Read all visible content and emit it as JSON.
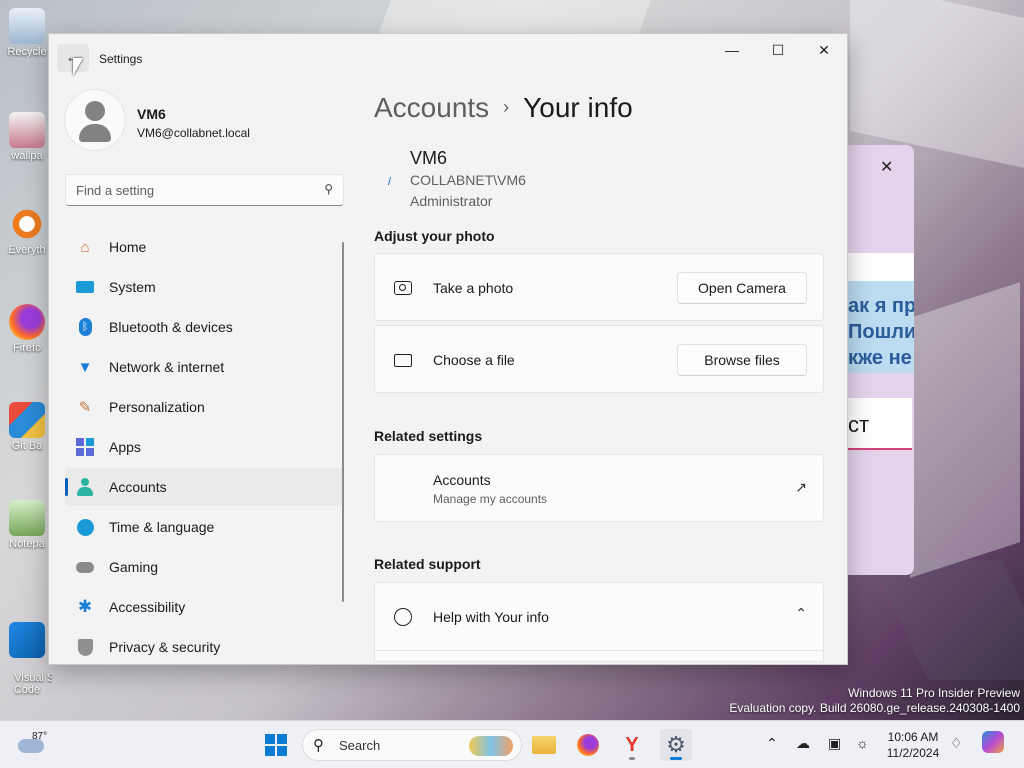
{
  "desktop": {
    "icons": [
      "Recycle",
      "wallpa",
      "Everyth",
      "Firefo",
      "Git Ba",
      "Notepa",
      "Visual St\nCode"
    ],
    "watermark_line1": "Windows 11 Pro Insider Preview",
    "watermark_line2": "Evaluation copy. Build 26080.ge_release.240308-1400"
  },
  "bg_dialog": {
    "close": "✕",
    "text_lines": [
      "ак я пр",
      "Пошли",
      "кже не"
    ],
    "input_text": "ст"
  },
  "window": {
    "title": "Settings",
    "back_glyph": "←",
    "minimize": "—",
    "maximize": "☐",
    "close": "✕"
  },
  "profile": {
    "name": "VM6",
    "email": "VM6@collabnet.local"
  },
  "search": {
    "placeholder": "Find a setting",
    "icon": "search-icon"
  },
  "nav": {
    "selected": "Accounts",
    "items": [
      {
        "label": "Home",
        "icon": "home-icon"
      },
      {
        "label": "System",
        "icon": "system-icon"
      },
      {
        "label": "Bluetooth & devices",
        "icon": "bluetooth-icon"
      },
      {
        "label": "Network & internet",
        "icon": "wifi-icon"
      },
      {
        "label": "Personalization",
        "icon": "brush-icon"
      },
      {
        "label": "Apps",
        "icon": "apps-icon"
      },
      {
        "label": "Accounts",
        "icon": "accounts-icon"
      },
      {
        "label": "Time & language",
        "icon": "globe-clock-icon"
      },
      {
        "label": "Gaming",
        "icon": "gamepad-icon"
      },
      {
        "label": "Accessibility",
        "icon": "accessibility-icon"
      },
      {
        "label": "Privacy & security",
        "icon": "shield-icon"
      }
    ]
  },
  "content": {
    "breadcrumb": {
      "parent": "Accounts",
      "separator": "›",
      "current": "Your info"
    },
    "user": {
      "name": "VM6",
      "domain": "COLLABNET\\VM6",
      "role": "Administrator"
    },
    "adjust_photo": {
      "title": "Adjust your photo",
      "take_photo": {
        "label": "Take a photo",
        "button": "Open Camera"
      },
      "choose_file": {
        "label": "Choose a file",
        "button": "Browse files"
      }
    },
    "related_settings": {
      "title": "Related settings",
      "accounts": {
        "title": "Accounts",
        "subtitle": "Manage my accounts"
      }
    },
    "related_support": {
      "title": "Related support",
      "help": {
        "label": "Help with Your info"
      }
    }
  },
  "taskbar": {
    "weather_temp": "87°",
    "search_label": "Search",
    "time": "10:06 AM",
    "date": "11/2/2024"
  },
  "colors": {
    "accent": "#005fb8",
    "window_bg": "#f3f3f3",
    "card_bg": "#fbfbfb"
  }
}
